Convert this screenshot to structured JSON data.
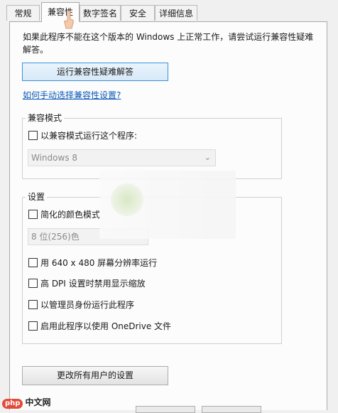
{
  "tabs": [
    {
      "label": "常规"
    },
    {
      "label": "兼容性",
      "active": true
    },
    {
      "label": "数字签名"
    },
    {
      "label": "安全"
    },
    {
      "label": "详细信息"
    }
  ],
  "intro_text": "如果此程序不能在这个版本的 Windows 上正常工作，请尝试运行兼容性疑难解答。",
  "troubleshoot_button": "运行兼容性疑难解答",
  "manual_link": "如何手动选择兼容性设置?",
  "compat_group": {
    "title": "兼容模式",
    "checkbox_label": "以兼容模式运行这个程序:",
    "select_value": "Windows 8"
  },
  "settings_group": {
    "title": "设置",
    "reduced_color_label": "简化的颜色模式",
    "color_select_value": "8 位(256)色",
    "options": [
      {
        "label": "用 640 x 480 屏幕分辨率运行",
        "checked": false
      },
      {
        "label": "高 DPI 设置时禁用显示缩放",
        "checked": false
      },
      {
        "label": "以管理员身份运行此程序",
        "checked": false
      },
      {
        "label": "启用此程序以使用 OneDrive 文件",
        "checked": false
      }
    ]
  },
  "all_users_button": "更改所有用户的设置",
  "watermark": {
    "badge": "php",
    "text": "中文网"
  },
  "colors": {
    "link": "#0a58b6",
    "accent_border": "#3c8fd8",
    "watermark_red": "#e24b39"
  }
}
